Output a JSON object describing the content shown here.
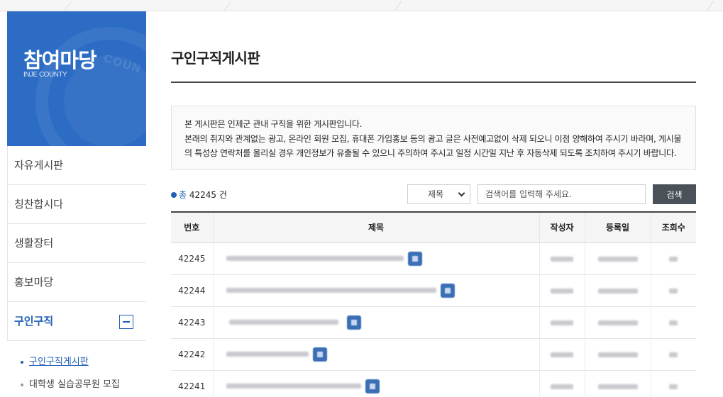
{
  "sidebar": {
    "title": "참여마당",
    "subtitle": "INJE COUNTY",
    "menu": [
      {
        "label": "자유게시판"
      },
      {
        "label": "칭찬합시다"
      },
      {
        "label": "생활장터"
      },
      {
        "label": "홍보마당"
      },
      {
        "label": "구인구직",
        "active": true
      }
    ],
    "submenu": [
      {
        "label": "구인구직게시판",
        "active": true
      },
      {
        "label": "대학생 실습공무원 모집"
      }
    ]
  },
  "main": {
    "page_title": "구인구직게시판",
    "notice": [
      "본 게시판은 인제군 관내 구직을 위한 게시판입니다.",
      "본래의 취지와 관계없는 광고, 온라인 회원 모집, 휴대폰 가입홍보 등의 광고 글은 사전예고없이 삭제 되오니 이점 양해하여 주시기 바라며, 게시물",
      "의 특성상 연락처를 올리실 경우 개인정보가 유출될 수 있으니 주의하여 주시고 일정 시간일 지난 후 자동삭제 되도록 조치하여 주시기 바랍니다."
    ],
    "total_label": "총",
    "total_count": "42245",
    "total_unit": "건",
    "search": {
      "field_selected": "제목",
      "placeholder": "검색어를 입력해 주세요.",
      "button_label": "검색"
    },
    "table": {
      "headers": [
        "번호",
        "제목",
        "작성자",
        "등록일",
        "조회수"
      ],
      "rows": [
        {
          "no": "42245"
        },
        {
          "no": "42244"
        },
        {
          "no": "42243"
        },
        {
          "no": "42242"
        },
        {
          "no": "42241"
        }
      ]
    }
  }
}
